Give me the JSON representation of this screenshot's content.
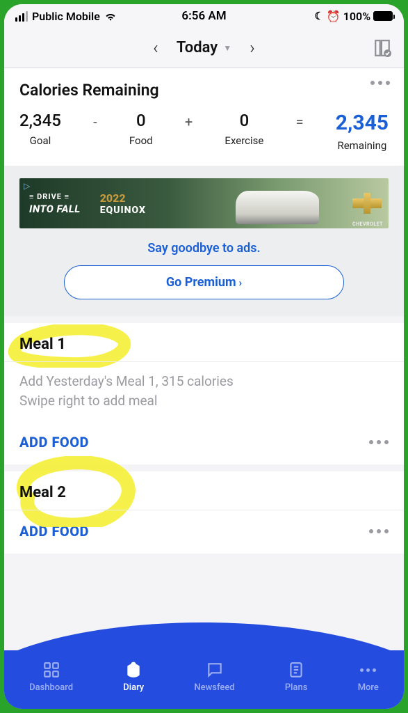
{
  "status_bar": {
    "carrier": "Public Mobile",
    "time": "6:56 AM",
    "battery_pct": "100%"
  },
  "nav": {
    "title": "Today"
  },
  "calories": {
    "title": "Calories Remaining",
    "goal_val": "2,345",
    "goal_lbl": "Goal",
    "food_val": "0",
    "food_lbl": "Food",
    "exercise_val": "0",
    "exercise_lbl": "Exercise",
    "remaining_val": "2,345",
    "remaining_lbl": "Remaining"
  },
  "ad": {
    "line1": "DRIVE",
    "line2": "INTO FALL",
    "year": "2022",
    "model": "EQUINOX",
    "brand": "CHEVROLET",
    "say_goodbye": "Say goodbye to ads.",
    "premium_btn": "Go Premium"
  },
  "meals": [
    {
      "name": "Meal 1",
      "hint_line1": "Add Yesterday's Meal 1, 315 calories",
      "hint_line2": "Swipe right to add meal",
      "add_label": "ADD FOOD"
    },
    {
      "name": "Meal 2",
      "add_label": "ADD FOOD"
    }
  ],
  "tabs": {
    "dashboard": "Dashboard",
    "diary": "Diary",
    "newsfeed": "Newsfeed",
    "plans": "Plans",
    "more": "More"
  }
}
